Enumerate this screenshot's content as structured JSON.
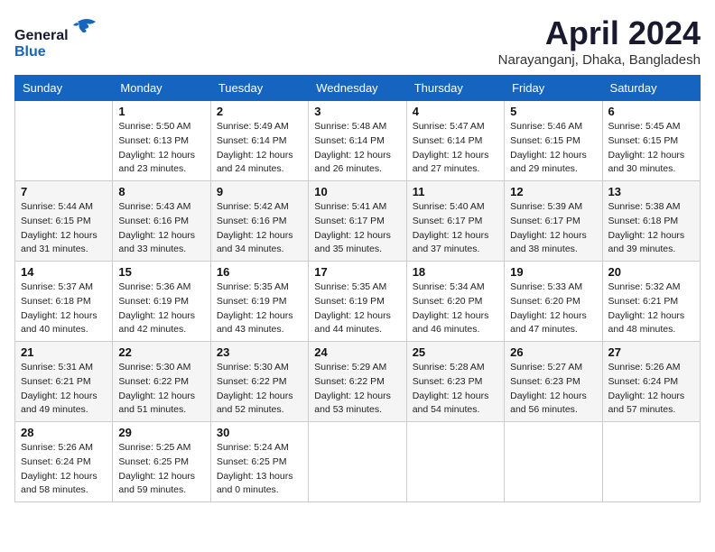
{
  "header": {
    "logo_line1": "General",
    "logo_line2": "Blue",
    "month_year": "April 2024",
    "location": "Narayanganj, Dhaka, Bangladesh"
  },
  "weekdays": [
    "Sunday",
    "Monday",
    "Tuesday",
    "Wednesday",
    "Thursday",
    "Friday",
    "Saturday"
  ],
  "weeks": [
    [
      {
        "day": "",
        "sunrise": "",
        "sunset": "",
        "daylight": ""
      },
      {
        "day": "1",
        "sunrise": "Sunrise: 5:50 AM",
        "sunset": "Sunset: 6:13 PM",
        "daylight": "Daylight: 12 hours and 23 minutes."
      },
      {
        "day": "2",
        "sunrise": "Sunrise: 5:49 AM",
        "sunset": "Sunset: 6:14 PM",
        "daylight": "Daylight: 12 hours and 24 minutes."
      },
      {
        "day": "3",
        "sunrise": "Sunrise: 5:48 AM",
        "sunset": "Sunset: 6:14 PM",
        "daylight": "Daylight: 12 hours and 26 minutes."
      },
      {
        "day": "4",
        "sunrise": "Sunrise: 5:47 AM",
        "sunset": "Sunset: 6:14 PM",
        "daylight": "Daylight: 12 hours and 27 minutes."
      },
      {
        "day": "5",
        "sunrise": "Sunrise: 5:46 AM",
        "sunset": "Sunset: 6:15 PM",
        "daylight": "Daylight: 12 hours and 29 minutes."
      },
      {
        "day": "6",
        "sunrise": "Sunrise: 5:45 AM",
        "sunset": "Sunset: 6:15 PM",
        "daylight": "Daylight: 12 hours and 30 minutes."
      }
    ],
    [
      {
        "day": "7",
        "sunrise": "Sunrise: 5:44 AM",
        "sunset": "Sunset: 6:15 PM",
        "daylight": "Daylight: 12 hours and 31 minutes."
      },
      {
        "day": "8",
        "sunrise": "Sunrise: 5:43 AM",
        "sunset": "Sunset: 6:16 PM",
        "daylight": "Daylight: 12 hours and 33 minutes."
      },
      {
        "day": "9",
        "sunrise": "Sunrise: 5:42 AM",
        "sunset": "Sunset: 6:16 PM",
        "daylight": "Daylight: 12 hours and 34 minutes."
      },
      {
        "day": "10",
        "sunrise": "Sunrise: 5:41 AM",
        "sunset": "Sunset: 6:17 PM",
        "daylight": "Daylight: 12 hours and 35 minutes."
      },
      {
        "day": "11",
        "sunrise": "Sunrise: 5:40 AM",
        "sunset": "Sunset: 6:17 PM",
        "daylight": "Daylight: 12 hours and 37 minutes."
      },
      {
        "day": "12",
        "sunrise": "Sunrise: 5:39 AM",
        "sunset": "Sunset: 6:17 PM",
        "daylight": "Daylight: 12 hours and 38 minutes."
      },
      {
        "day": "13",
        "sunrise": "Sunrise: 5:38 AM",
        "sunset": "Sunset: 6:18 PM",
        "daylight": "Daylight: 12 hours and 39 minutes."
      }
    ],
    [
      {
        "day": "14",
        "sunrise": "Sunrise: 5:37 AM",
        "sunset": "Sunset: 6:18 PM",
        "daylight": "Daylight: 12 hours and 40 minutes."
      },
      {
        "day": "15",
        "sunrise": "Sunrise: 5:36 AM",
        "sunset": "Sunset: 6:19 PM",
        "daylight": "Daylight: 12 hours and 42 minutes."
      },
      {
        "day": "16",
        "sunrise": "Sunrise: 5:35 AM",
        "sunset": "Sunset: 6:19 PM",
        "daylight": "Daylight: 12 hours and 43 minutes."
      },
      {
        "day": "17",
        "sunrise": "Sunrise: 5:35 AM",
        "sunset": "Sunset: 6:19 PM",
        "daylight": "Daylight: 12 hours and 44 minutes."
      },
      {
        "day": "18",
        "sunrise": "Sunrise: 5:34 AM",
        "sunset": "Sunset: 6:20 PM",
        "daylight": "Daylight: 12 hours and 46 minutes."
      },
      {
        "day": "19",
        "sunrise": "Sunrise: 5:33 AM",
        "sunset": "Sunset: 6:20 PM",
        "daylight": "Daylight: 12 hours and 47 minutes."
      },
      {
        "day": "20",
        "sunrise": "Sunrise: 5:32 AM",
        "sunset": "Sunset: 6:21 PM",
        "daylight": "Daylight: 12 hours and 48 minutes."
      }
    ],
    [
      {
        "day": "21",
        "sunrise": "Sunrise: 5:31 AM",
        "sunset": "Sunset: 6:21 PM",
        "daylight": "Daylight: 12 hours and 49 minutes."
      },
      {
        "day": "22",
        "sunrise": "Sunrise: 5:30 AM",
        "sunset": "Sunset: 6:22 PM",
        "daylight": "Daylight: 12 hours and 51 minutes."
      },
      {
        "day": "23",
        "sunrise": "Sunrise: 5:30 AM",
        "sunset": "Sunset: 6:22 PM",
        "daylight": "Daylight: 12 hours and 52 minutes."
      },
      {
        "day": "24",
        "sunrise": "Sunrise: 5:29 AM",
        "sunset": "Sunset: 6:22 PM",
        "daylight": "Daylight: 12 hours and 53 minutes."
      },
      {
        "day": "25",
        "sunrise": "Sunrise: 5:28 AM",
        "sunset": "Sunset: 6:23 PM",
        "daylight": "Daylight: 12 hours and 54 minutes."
      },
      {
        "day": "26",
        "sunrise": "Sunrise: 5:27 AM",
        "sunset": "Sunset: 6:23 PM",
        "daylight": "Daylight: 12 hours and 56 minutes."
      },
      {
        "day": "27",
        "sunrise": "Sunrise: 5:26 AM",
        "sunset": "Sunset: 6:24 PM",
        "daylight": "Daylight: 12 hours and 57 minutes."
      }
    ],
    [
      {
        "day": "28",
        "sunrise": "Sunrise: 5:26 AM",
        "sunset": "Sunset: 6:24 PM",
        "daylight": "Daylight: 12 hours and 58 minutes."
      },
      {
        "day": "29",
        "sunrise": "Sunrise: 5:25 AM",
        "sunset": "Sunset: 6:25 PM",
        "daylight": "Daylight: 12 hours and 59 minutes."
      },
      {
        "day": "30",
        "sunrise": "Sunrise: 5:24 AM",
        "sunset": "Sunset: 6:25 PM",
        "daylight": "Daylight: 13 hours and 0 minutes."
      },
      {
        "day": "",
        "sunrise": "",
        "sunset": "",
        "daylight": ""
      },
      {
        "day": "",
        "sunrise": "",
        "sunset": "",
        "daylight": ""
      },
      {
        "day": "",
        "sunrise": "",
        "sunset": "",
        "daylight": ""
      },
      {
        "day": "",
        "sunrise": "",
        "sunset": "",
        "daylight": ""
      }
    ]
  ]
}
